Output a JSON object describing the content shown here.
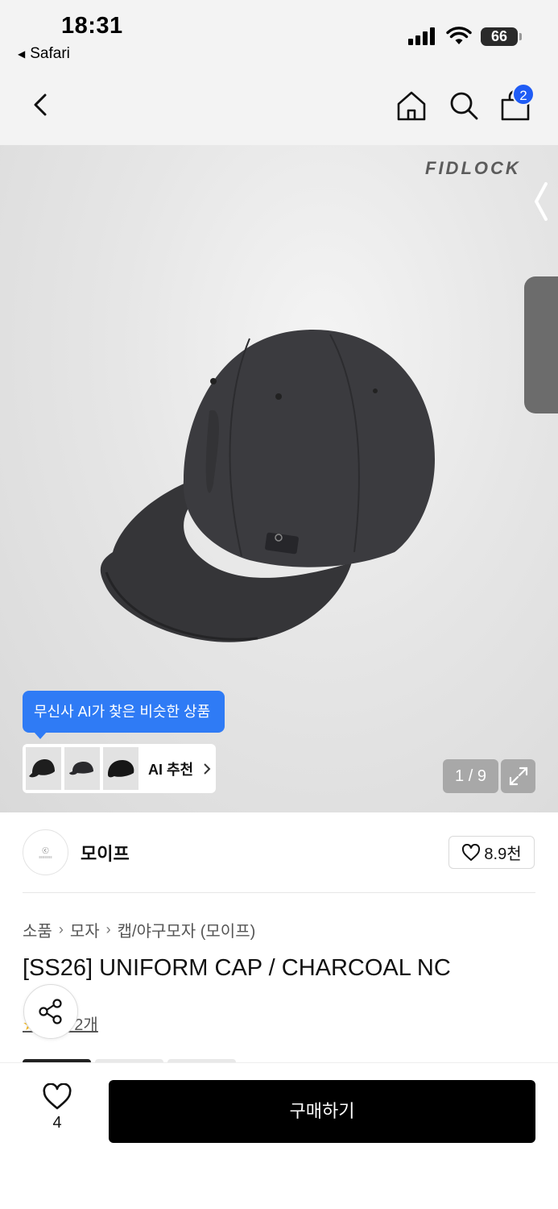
{
  "status_bar": {
    "time": "18:31",
    "back_app": "Safari",
    "battery": "66"
  },
  "nav": {
    "cart_count": "2"
  },
  "hero": {
    "watermark": "FIDLOCK",
    "ai_tooltip": "무신사 AI가 찾은 비슷한 상품",
    "ai_label": "AI 추천",
    "counter": "1 / 9"
  },
  "brand": {
    "name": "모이프",
    "likes": "8.9천"
  },
  "breadcrumb": [
    "소품",
    "모자",
    "캡/야구모자 (모이프)"
  ],
  "product": {
    "title": "[SS26] UNIFORM CAP / CHARCOAL NC",
    "review_text": "후기 2개"
  },
  "bottom": {
    "wish_count": "4",
    "buy_label": "구매하기"
  },
  "colors": {
    "accent_blue": "#2f7bf5",
    "badge_blue": "#1f5cf5",
    "buy_button": "#000000"
  }
}
